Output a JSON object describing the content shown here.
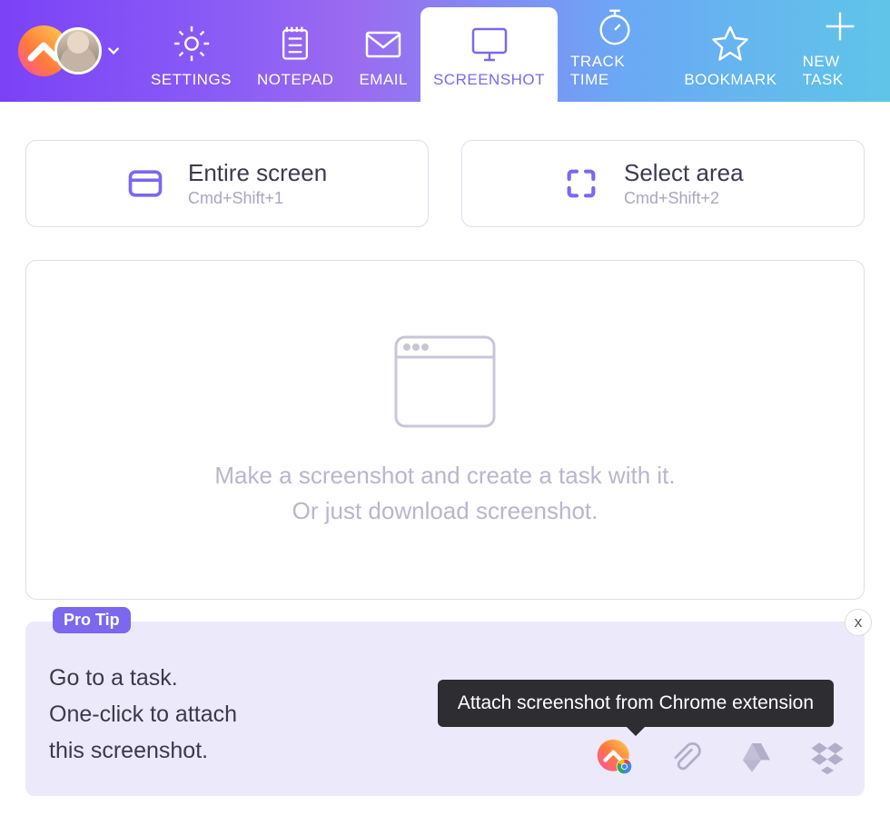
{
  "header": {
    "tabs": [
      {
        "id": "settings",
        "label": "SETTINGS"
      },
      {
        "id": "notepad",
        "label": "NOTEPAD"
      },
      {
        "id": "email",
        "label": "EMAIL"
      },
      {
        "id": "screenshot",
        "label": "SCREENSHOT"
      },
      {
        "id": "tracktime",
        "label": "TRACK TIME"
      },
      {
        "id": "bookmark",
        "label": "BOOKMARK"
      },
      {
        "id": "newtask",
        "label": "NEW TASK"
      }
    ]
  },
  "options": {
    "entire": {
      "title": "Entire screen",
      "shortcut": "Cmd+Shift+1"
    },
    "area": {
      "title": "Select area",
      "shortcut": "Cmd+Shift+2"
    }
  },
  "drop": {
    "line1": "Make a screenshot and create a task with it.",
    "line2": "Or just download screenshot."
  },
  "protip": {
    "badge": "Pro Tip",
    "line1": "Go to a task.",
    "line2": "One-click to attach",
    "line3": "this screenshot.",
    "close": "x",
    "tooltip": "Attach screenshot from Chrome extension"
  }
}
